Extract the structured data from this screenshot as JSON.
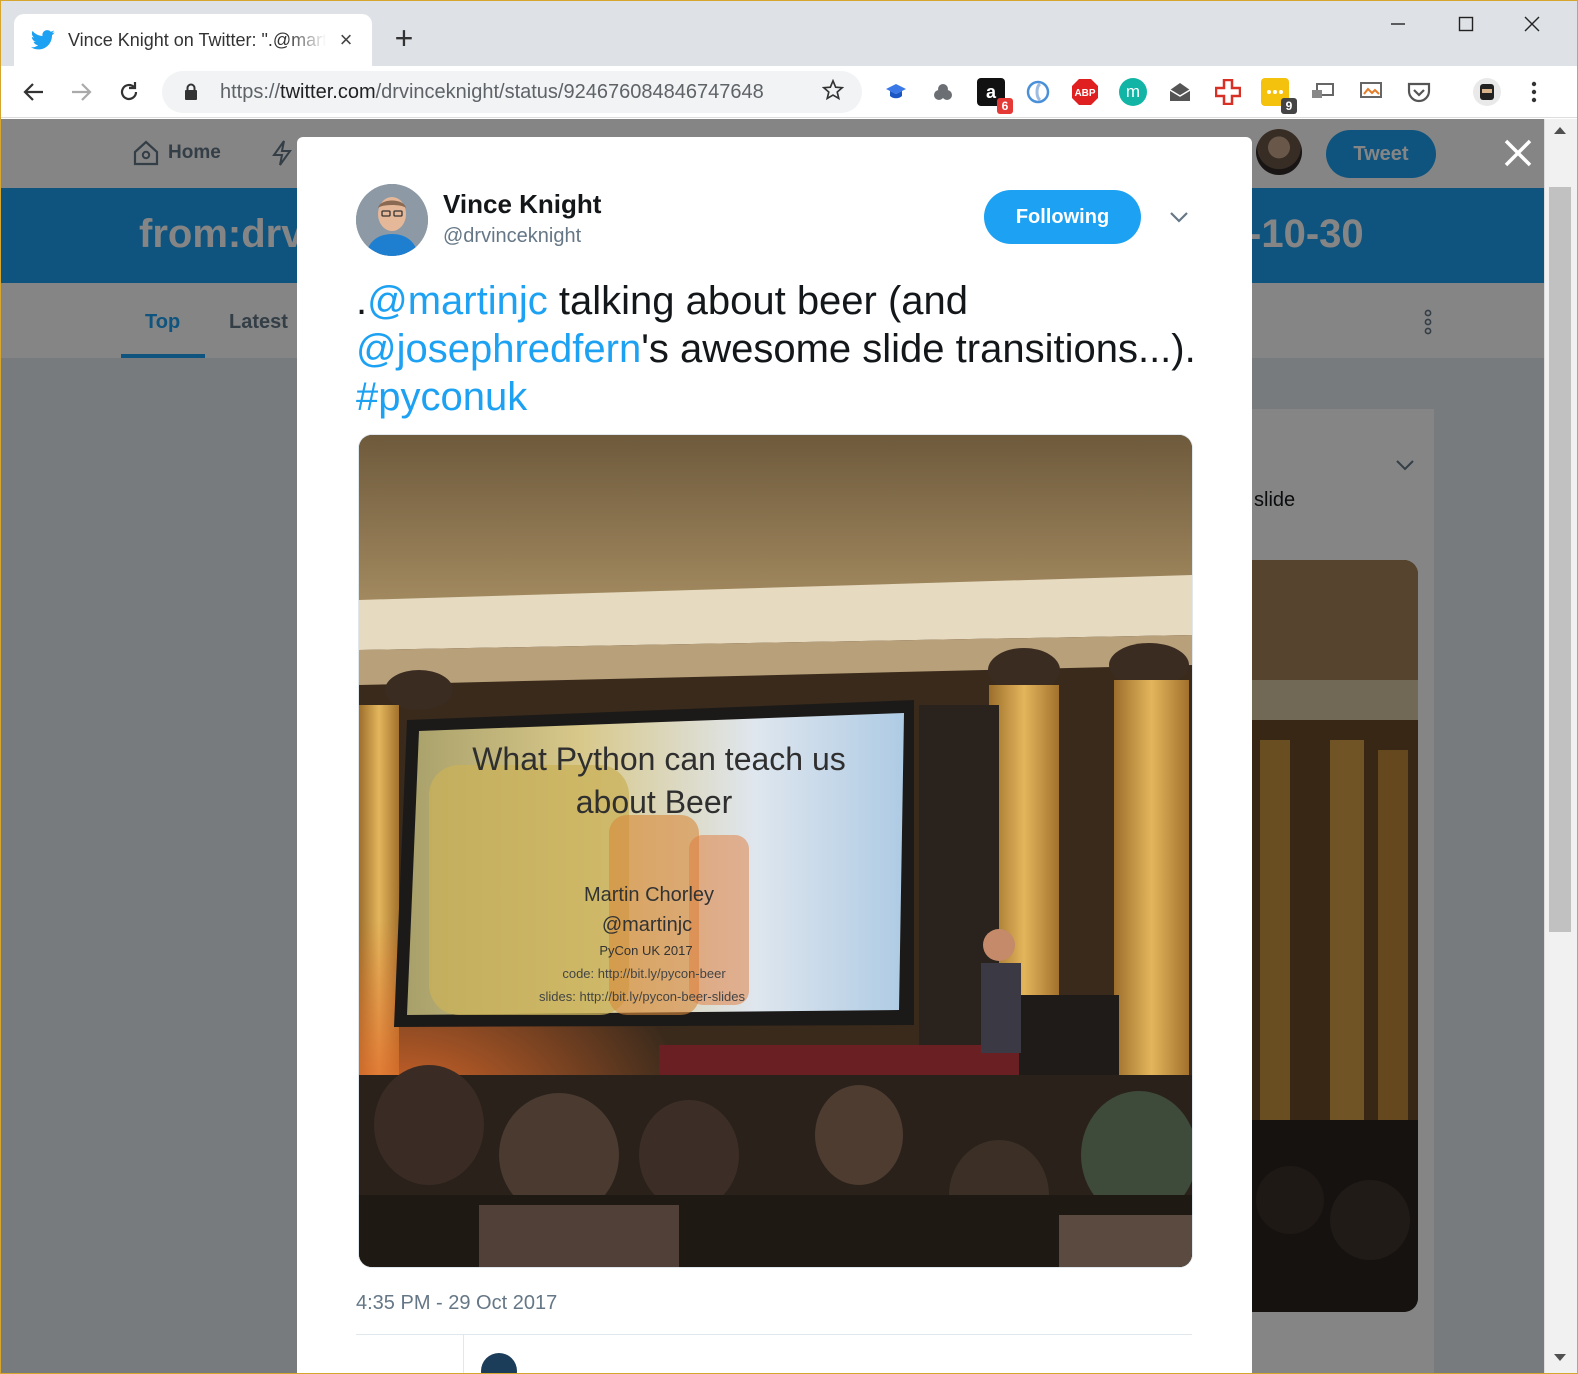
{
  "browser": {
    "tab_title": "Vince Knight on Twitter: \".@martinjc talking about beer",
    "tab_close": "×",
    "new_tab": "+",
    "url_scheme": "https://",
    "url_host": "twitter.com",
    "url_path": "/drvinceknight/status/924676084846747648",
    "extensions": [
      {
        "name": "mortarboard",
        "color": "#3b78e7",
        "badge": ""
      },
      {
        "name": "cloud",
        "color": "#5f6368",
        "badge": ""
      },
      {
        "name": "amazon",
        "color": "#111111",
        "badge": "6"
      },
      {
        "name": "pulse",
        "color": "#4a90d9",
        "badge": ""
      },
      {
        "name": "adblock",
        "color": "#e02020",
        "label": "ABP",
        "badge": ""
      },
      {
        "name": "m",
        "color": "#12b5a5",
        "label": "m",
        "badge": ""
      },
      {
        "name": "mail",
        "color": "#5f6368",
        "badge": ""
      },
      {
        "name": "plus",
        "color": "#d93025",
        "badge": ""
      },
      {
        "name": "notes",
        "color": "#f4c20d",
        "badge": "9"
      },
      {
        "name": "cast",
        "color": "#5f6368",
        "badge": ""
      },
      {
        "name": "screen",
        "color": "#5f6368",
        "badge": ""
      },
      {
        "name": "pocket",
        "color": "#5f6368",
        "badge": ""
      }
    ]
  },
  "twitter_nav": {
    "home": "Home",
    "tweet_button": "Tweet"
  },
  "search": {
    "banner_left": "from:drv",
    "banner_right": "-10-30",
    "tab_top": "Top",
    "tab_latest": "Latest"
  },
  "background_tweet": {
    "fragment": "slide"
  },
  "tweet": {
    "author_name": "Vince Knight",
    "author_handle": "@drvinceknight",
    "follow_label": "Following",
    "text_prefix": ".",
    "mention1": "@martinjc",
    "text_mid1": " talking about beer (and ",
    "mention2": "@josephredfern",
    "text_mid2": "'s awesome slide transitions...). ",
    "hashtag": "#pyconuk",
    "timestamp": "4:35 PM - 29 Oct 2017"
  },
  "slide": {
    "title_line1": "What Python can teach us",
    "title_line2": "about Beer",
    "speaker": "Martin Chorley",
    "handle": "@martinjc",
    "event": "PyCon UK 2017",
    "code": "code: http://bit.ly/pycon-beer",
    "slides": "slides: http://bit.ly/pycon-beer-slides"
  },
  "colors": {
    "twitter_blue": "#1da1f2",
    "text_dark": "#14171a",
    "text_grey": "#657786"
  }
}
